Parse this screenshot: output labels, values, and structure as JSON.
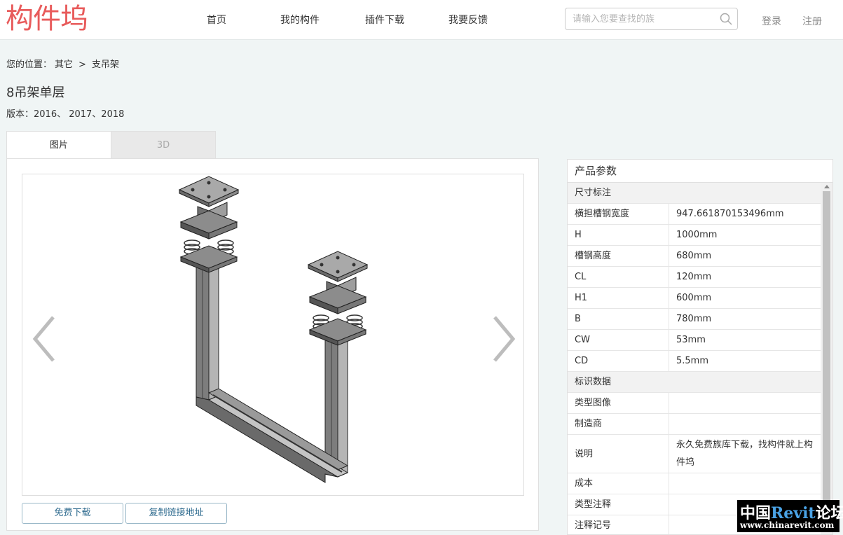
{
  "header": {
    "logo": "构件坞",
    "nav": [
      "首页",
      "我的构件",
      "插件下载",
      "我要反馈"
    ],
    "search_placeholder": "请输入您要查找的族",
    "login": "登录",
    "register": "注册"
  },
  "breadcrumb": {
    "prefix": "您的位置：",
    "items": [
      "其它",
      ">",
      "支吊架"
    ]
  },
  "title": "8吊架单层",
  "version": "版本：2016、 2017、2018",
  "tabs": [
    "图片",
    "3D"
  ],
  "buttons": {
    "download": "免费下载",
    "copy_link": "复制链接地址"
  },
  "params": {
    "heading": "产品参数",
    "group1": "尺寸标注",
    "rows1": [
      {
        "k": "横担槽钢宽度",
        "v": "947.661870153496mm"
      },
      {
        "k": "H",
        "v": "1000mm"
      },
      {
        "k": "槽钢高度",
        "v": "680mm"
      },
      {
        "k": "CL",
        "v": "120mm"
      },
      {
        "k": "H1",
        "v": "600mm"
      },
      {
        "k": "B",
        "v": "780mm"
      },
      {
        "k": "CW",
        "v": "53mm"
      },
      {
        "k": "CD",
        "v": "5.5mm"
      }
    ],
    "group2": "标识数据",
    "rows2": [
      {
        "k": "类型图像",
        "v": ""
      },
      {
        "k": "制造商",
        "v": ""
      },
      {
        "k": "说明",
        "v": "永久免费族库下载，找构件就上构件坞"
      },
      {
        "k": "成本",
        "v": ""
      },
      {
        "k": "类型注释",
        "v": ""
      },
      {
        "k": "注释记号",
        "v": ""
      }
    ]
  },
  "watermark": {
    "line1_a": "中国",
    "line1_b": "Revit",
    "line1_c": "论坛",
    "line2": "www.chinarevit.com"
  }
}
